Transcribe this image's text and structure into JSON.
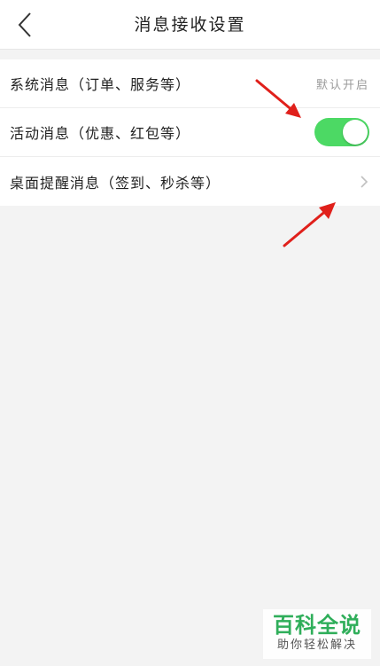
{
  "header": {
    "title": "消息接收设置",
    "back_icon": "chevron-left-icon"
  },
  "settings": {
    "items": [
      {
        "label": "系统消息（订单、服务等）",
        "value": "默认开启"
      },
      {
        "label": "活动消息（优惠、红包等）",
        "toggle_on": true
      },
      {
        "label": "桌面提醒消息（签到、秒杀等）",
        "chevron": "chevron-right-icon"
      }
    ]
  },
  "colors": {
    "toggle_on": "#4cd964",
    "annotation_arrow": "#e0201b",
    "watermark_green": "#2fae5a"
  },
  "watermark": {
    "title": "百科全说",
    "subtitle": "助你轻松解决"
  }
}
